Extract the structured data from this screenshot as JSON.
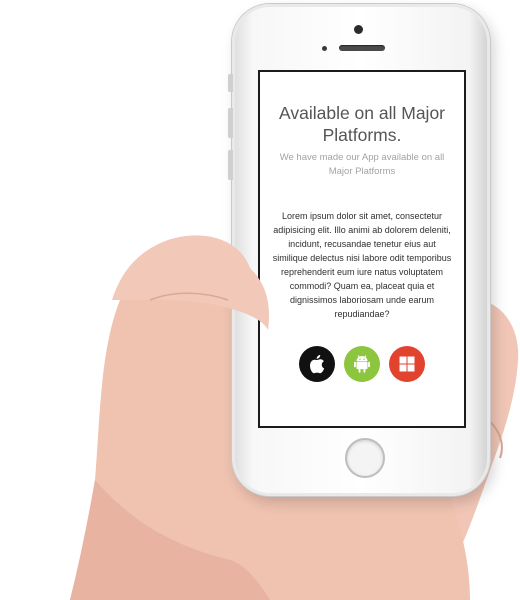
{
  "screen": {
    "headline": "Available on all Major Platforms.",
    "subheadline": "We have made our App available on all Major Platforms",
    "body": "Lorem ipsum dolor sit amet, consectetur adipisicing elit. Illo animi ab dolorem deleniti, incidunt, recusandae tenetur eius aut similique delectus nisi labore odit temporibus reprehenderit eum iure natus voluptatem commodi? Quam ea, placeat quia et dignissimos laboriosam unde earum repudiandae?",
    "platforms": [
      {
        "icon": "apple-icon",
        "color": "#111111"
      },
      {
        "icon": "android-icon",
        "color": "#8cc63f"
      },
      {
        "icon": "windows-icon",
        "color": "#e1432e"
      }
    ]
  },
  "colors": {
    "headline": "#555555",
    "subheadline": "#a3a3a3",
    "phone_body": "#f5f5f5",
    "skin": "#f0c3b1"
  }
}
